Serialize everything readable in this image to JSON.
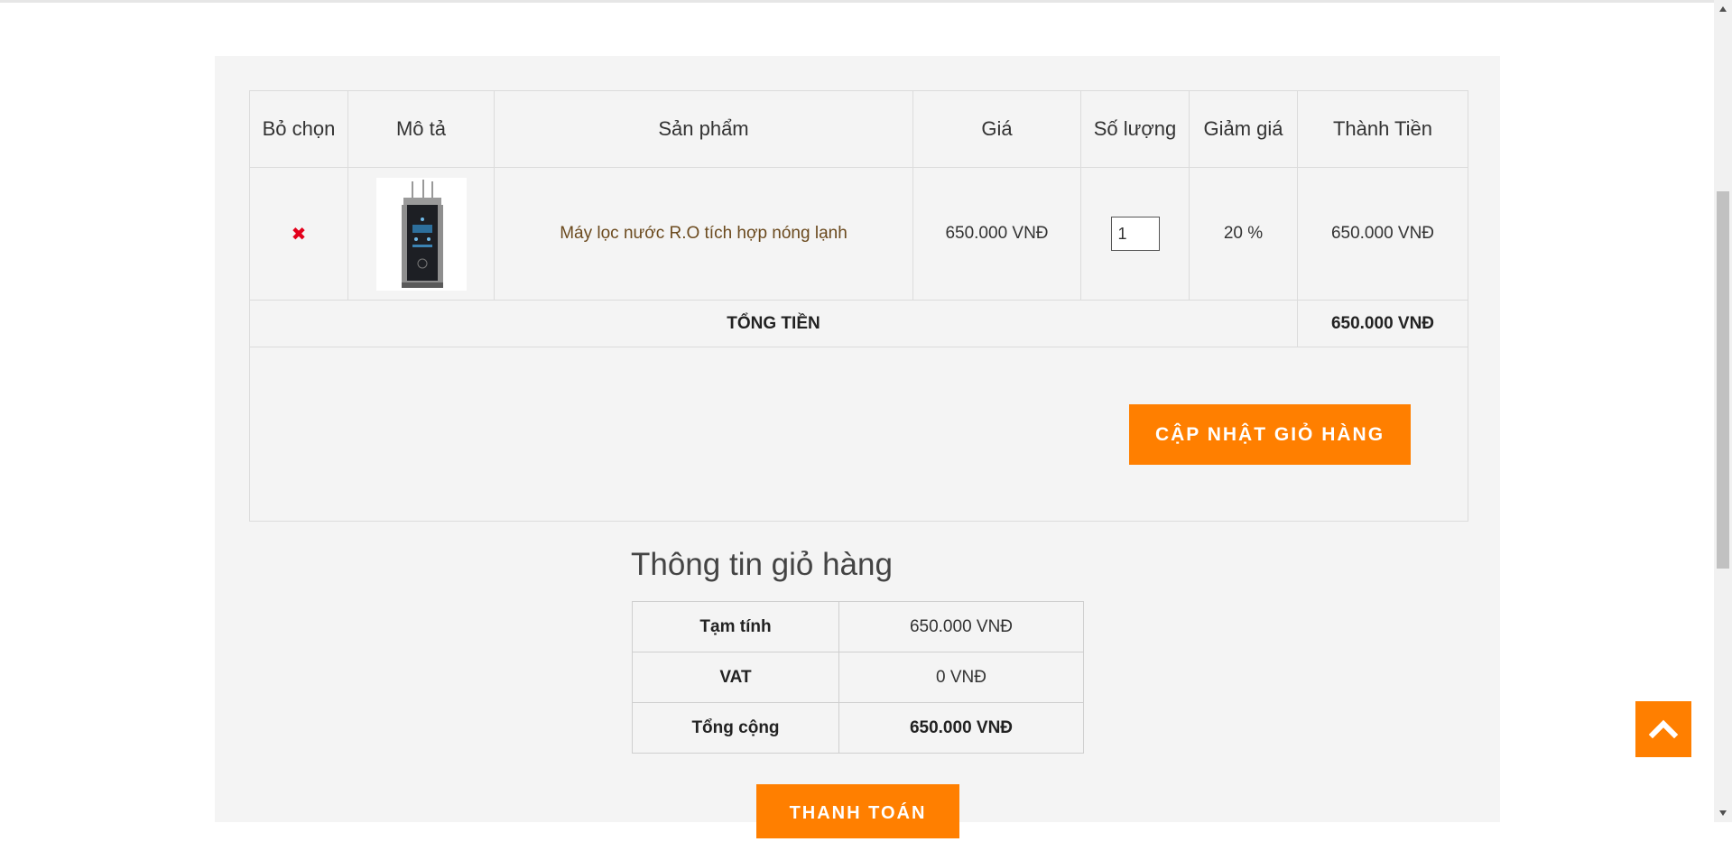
{
  "cart_table": {
    "headers": {
      "remove": "Bỏ chọn",
      "description": "Mô tả",
      "product": "Sản phẩm",
      "price": "Giá",
      "quantity": "Số lượng",
      "discount": "Giảm giá",
      "subtotal": "Thành Tiền"
    },
    "items": [
      {
        "remove_icon": "close-icon",
        "image_icon": "water-purifier-image",
        "product_name": "Máy lọc nước R.O tích hợp nóng lạnh",
        "price": "650.000 VNĐ",
        "quantity": "1",
        "discount": "20 %",
        "subtotal": "650.000 VNĐ"
      }
    ],
    "total_label": "TỔNG TIỀN",
    "total_value": "650.000 VNĐ",
    "update_button": "CẬP NHẬT GIỎ HÀNG"
  },
  "cart_summary": {
    "title": "Thông tin giỏ hàng",
    "rows": [
      {
        "label": "Tạm tính",
        "value": "650.000 VNĐ"
      },
      {
        "label": "VAT",
        "value": "0 VNĐ"
      },
      {
        "label": "Tổng cộng",
        "value": "650.000 VNĐ"
      }
    ],
    "checkout_button": "THANH TOÁN"
  },
  "back_to_top_icon": "chevron-up-icon",
  "colors": {
    "accent": "#ff7f00",
    "panel_bg": "#f4f4f4",
    "remove_red": "#e3001b",
    "product_link": "#6b4a1e"
  }
}
